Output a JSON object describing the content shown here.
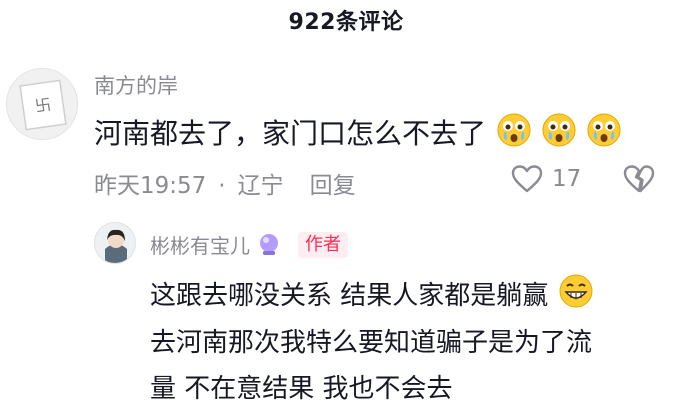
{
  "header": {
    "title": "922条评论"
  },
  "comment": {
    "username": "南方的岸",
    "text": "河南都去了，家门口怎么不去了",
    "emoji_count": 3,
    "emoji_name": "crying-face-emoji",
    "time": "昨天19:57",
    "separator": "·",
    "location": "辽宁",
    "reply_label": "回复",
    "likes": "17"
  },
  "reply": {
    "username": "彬彬有宝儿",
    "badge": "作者",
    "line1": "这跟去哪没关系 结果人家都是躺赢",
    "line2": "去河南那次我特么要知道骗子是为了流",
    "line3": "量 不在意结果 我也不会去"
  },
  "colors": {
    "primary_text": "#161823",
    "secondary_text": "#8a8b91",
    "author_badge": "#fe2c55",
    "author_badge_bg": "#ffeef1"
  }
}
